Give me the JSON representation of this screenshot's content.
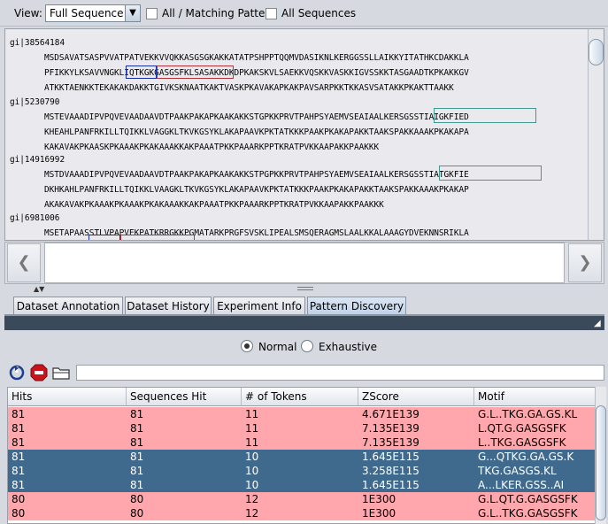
{
  "toolbar": {
    "view_label": "View:",
    "view_value": "Full Sequence",
    "all_matching_label": "All / Matching Pattern",
    "all_sequences_label": "All Sequences"
  },
  "sequences": [
    {
      "id": "gi|38564184",
      "lines": [
        "MSDSAVATSASPVVATPATVEKKVVQKKASGSGKAKKATATPSHPPTQQMVDASIKNLKERGGSSLLAIKKYITATHKCDAKKLA",
        "PFIKKYLKSAVVNGKLIQTKGKGASGSFKLSASAKKDKDPKAKSKVLSAEKKVQSKKVASKKIGVSSKKTASGAADTKPKAKKGV",
        "ATKKTAENKKTEKAKAKDAKKTGIVKSKNAATKAKTVASKPKAVAKAPKAKPAVSARPKKTKKASVSATAKKPKAKTTAAKK"
      ]
    },
    {
      "id": "gi|5230790",
      "lines": [
        "MSTEVAAADIPVPQVEVAADAAVDTPAAKPAKAPKAAKAKKSTGPKKPRVTPAHPSYAEMVSEAIAALKERSGSSTIAIGKFIED",
        "KHEAHLPANFRKILLTQIKKLVAGGKLTKVKGSYKLAKAPAAVKPKTATKKKPAAKPKAKAPAKKTAAKSPAKKAAAKPKAKAPA",
        "KAKAVAKPKAASKPKAAAKPKAKAAAKKAKPAAATPKKPAAARKPPTKRATPVKKAAPAKKPAAKKK"
      ]
    },
    {
      "id": "gi|14916992",
      "lines": [
        "MSTDVAAADIPVPQVEVAADAAVDTPAAKPAKAPKAAKAKKSTPGPKKPRVTPAHPSYAEMVSEAIAALKERSGSSTIATGKFIE",
        "DKHKAHLPANFRKILLTQIKKLVAAGKLTKVKGSYKLAKAPAAVKPKTATKKKPAAKPKAKAPAKKTAAKSPAKKAAAKPKAKAP",
        "AKAKAVAKPKAAAKPKAAAKPKAKAAAKKAKPAAATPKKPAAARKPPTKRATPVKKAAPAKKPAAKKK"
      ]
    },
    {
      "id": "gi|6981006",
      "lines": [
        "MSETAPAASSTLVPAPVEKPATKRRGKKPGMATARKPRGFSVSKLIPEALSMSQERAGMSLAALKKALAAAGYDVEKNNSRIKLA"
      ]
    }
  ],
  "tabs": [
    "Dataset Annotation",
    "Dataset History",
    "Experiment Info",
    "Pattern Discovery"
  ],
  "active_tab": "Pattern Discovery",
  "mode": {
    "normal_label": "Normal",
    "exhaustive_label": "Exhaustive",
    "selected": "Normal"
  },
  "table": {
    "headers": [
      "Hits",
      "Sequences Hit",
      "# of Tokens",
      "ZScore",
      "Motif"
    ],
    "rows": [
      [
        "81",
        "81",
        "11",
        "4.671E139",
        "G.L..TKG.GA.GS.KL"
      ],
      [
        "81",
        "81",
        "11",
        "7.135E139",
        "L.QT.G.GASGSFK"
      ],
      [
        "81",
        "81",
        "11",
        "7.135E139",
        "L..TKG.GASGSFK"
      ],
      [
        "81",
        "81",
        "10",
        "1.645E115",
        "G...QTKG.GA.GS.K"
      ],
      [
        "81",
        "81",
        "10",
        "3.258E115",
        "TKG.GASGS.KL"
      ],
      [
        "81",
        "81",
        "10",
        "1.645E115",
        "A...LKER.GSS..AI"
      ],
      [
        "80",
        "80",
        "12",
        "1E300",
        "G.L.QT.G.GASGSFK"
      ],
      [
        "80",
        "80",
        "12",
        "1E300",
        "G.L..TKG.GASGSFK"
      ]
    ],
    "row_colors": [
      "pink",
      "pink",
      "pink",
      "blue",
      "blue",
      "blue",
      "pink",
      "pink"
    ]
  },
  "colors": {
    "pink_row": "#ffa7ac",
    "blue_row": "#3f6a8d",
    "pattern_blue": "#1a2ea8",
    "pattern_red": "#b5313a",
    "pattern_teal": "#3f9a94"
  },
  "icons": [
    "refresh-icon",
    "stop-icon",
    "folder-icon",
    "nav-left-icon",
    "nav-right-icon",
    "resize-corner-icon"
  ]
}
